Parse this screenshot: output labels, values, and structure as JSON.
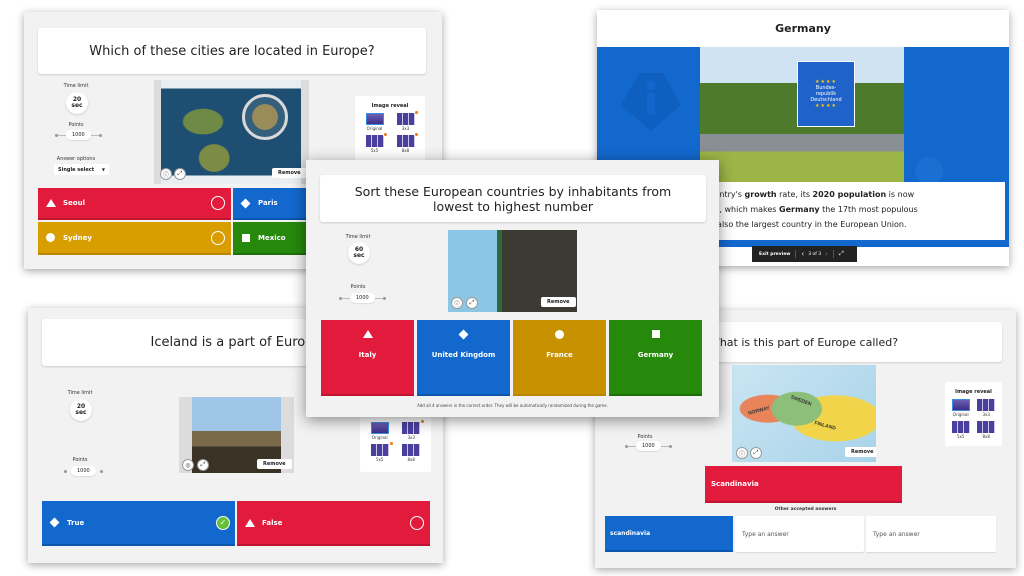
{
  "colors": {
    "red": "#e21b3c",
    "blue": "#1368ce",
    "yellow": "#d89e00",
    "green": "#26890c",
    "slide_blue": "#1368ce",
    "badge_orange": "#f07a1a",
    "correct_green": "#66bf39"
  },
  "card1": {
    "question": "Which of these cities are located in Europe?",
    "time_limit_label": "Time limit",
    "time_value": "20",
    "time_unit": "sec",
    "points_label": "Points",
    "points_value": "1000",
    "answer_options_label": "Answer options",
    "answer_options_value": "Single select",
    "image_icon": "world-map-magnifier-photo",
    "remove_label": "Remove",
    "image_reveal": {
      "title": "Image reveal",
      "options": [
        "Original",
        "3x3",
        "5x5",
        "8x8"
      ]
    },
    "answers": [
      {
        "label": "Seoul",
        "shape": "triangle",
        "color": "red",
        "correct": false
      },
      {
        "label": "Paris",
        "shape": "diamond",
        "color": "blue",
        "correct": false
      },
      {
        "label": "Sydney",
        "shape": "circle",
        "color": "yellow",
        "correct": false
      },
      {
        "label": "Mexico",
        "shape": "square",
        "color": "green",
        "correct": false
      }
    ]
  },
  "card2": {
    "title": "Germany",
    "sign_text": [
      "Bundes-",
      "republik",
      "Deutschland"
    ],
    "text_runs": [
      {
        "t": "country's ",
        "b": false
      },
      {
        "t": "growth",
        "b": true
      },
      {
        "t": " rate, its ",
        "b": false
      },
      {
        "t": "2020 population",
        "b": true
      },
      {
        "t": " is now",
        "b": false
      }
    ],
    "text_line2": [
      {
        "t": "lion, which makes ",
        "b": false
      },
      {
        "t": "Germany",
        "b": true
      },
      {
        "t": " the 17th most populous",
        "b": false
      }
    ],
    "text_line3": [
      {
        "t": "t's also the largest country in the European Union.",
        "b": false
      }
    ],
    "preview": {
      "exit_label": "Exit preview",
      "page": "3 of 3"
    }
  },
  "card3": {
    "question": "Sort these European countries by inhabitants from lowest to highest number",
    "time_limit_label": "Time limit",
    "time_value": "60",
    "time_unit": "sec",
    "points_label": "Points",
    "points_value": "1000",
    "remove_label": "Remove",
    "answers": [
      {
        "label": "Italy",
        "shape": "triangle",
        "color": "red"
      },
      {
        "label": "United Kingdom",
        "shape": "diamond",
        "color": "blue"
      },
      {
        "label": "France",
        "shape": "circle",
        "color": "yellow"
      },
      {
        "label": "Germany",
        "shape": "square",
        "color": "green"
      }
    ],
    "footer": "Add all 4 answers in the correct order. They will be automatically randomized during the game."
  },
  "card4": {
    "question": "Iceland is a part of Europe",
    "time_limit_label": "Time limit",
    "time_value": "20",
    "time_unit": "sec",
    "points_label": "Points",
    "points_value": "1000",
    "remove_label": "Remove",
    "image_reveal": {
      "options": [
        "Original",
        "3x3",
        "5x5",
        "8x8"
      ]
    },
    "answers": [
      {
        "label": "True",
        "shape": "diamond",
        "color": "blue",
        "correct": true
      },
      {
        "label": "False",
        "shape": "triangle",
        "color": "red",
        "correct": false
      }
    ]
  },
  "card5": {
    "question": "What is this part of Europe called?",
    "points_label": "Points",
    "points_value": "1000",
    "remove_label": "Remove",
    "map_labels": [
      "SWEDEN",
      "NORWAY",
      "FINLAND"
    ],
    "image_reveal": {
      "title": "Image reveal",
      "options": [
        "Original",
        "3x3",
        "5x5",
        "8x8"
      ]
    },
    "main_answer": "Scandinavia",
    "other_label": "Other accepted answers",
    "other_answers": [
      {
        "value": "scandinavia",
        "placeholder": "Type an answer"
      },
      {
        "value": "",
        "placeholder": "Type an answer"
      },
      {
        "value": "",
        "placeholder": "Type an answer"
      }
    ]
  }
}
